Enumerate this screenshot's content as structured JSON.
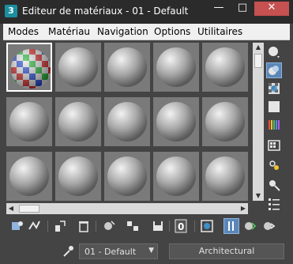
{
  "window": {
    "title": "Editeur de matériaux - 01 - Default",
    "app_icon": "3",
    "minimize": "—",
    "maximize": "□",
    "close": "✕"
  },
  "menu": {
    "items": [
      "Modes",
      "Matériau",
      "Navigation",
      "Options",
      "Utilitaires"
    ]
  },
  "grid": {
    "rows": 3,
    "cols": 5,
    "selected_slot": 0,
    "selected_slot_pattern": "checker-map"
  },
  "scrollbars": {
    "up_arrow": "▲",
    "down_arrow": "▼",
    "left_arrow": "◀",
    "right_arrow": "▶"
  },
  "side_tools": [
    {
      "icon": "sample-type-icon",
      "active": false
    },
    {
      "icon": "backlight-icon",
      "active": true
    },
    {
      "icon": "background-checker-icon",
      "active": false
    },
    {
      "icon": "sample-uv-tiling-icon",
      "active": false
    },
    {
      "icon": "video-color-check-icon",
      "active": false
    },
    {
      "icon": "make-preview-icon",
      "active": false
    },
    {
      "icon": "options-icon",
      "active": false
    },
    {
      "icon": "select-by-material-icon",
      "active": false
    },
    {
      "icon": "material-map-navigator-icon",
      "active": false
    }
  ],
  "bottom_tools": {
    "number_field": "0"
  },
  "footer": {
    "material_name": "01 - Default",
    "material_type": "Architectural"
  },
  "colors": {
    "accent": "#5b87b8",
    "close": "#c75050",
    "frame": "#444444"
  }
}
